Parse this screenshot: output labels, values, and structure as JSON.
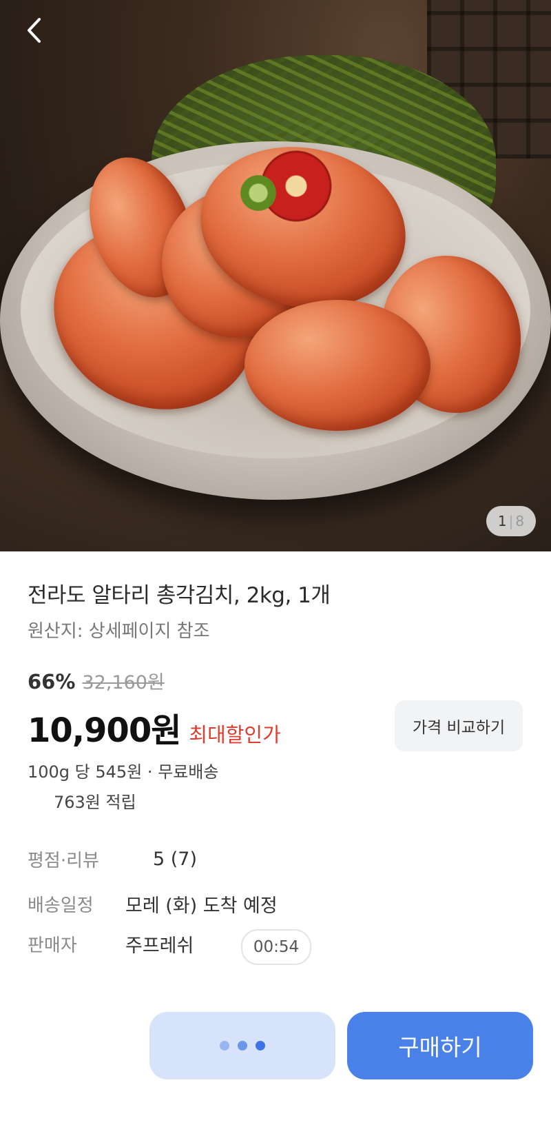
{
  "hero": {
    "back_icon": "chevron-left-icon",
    "image_index": "1",
    "image_separator": "|",
    "image_total": "8"
  },
  "product": {
    "title": "전라도 알타리 총각김치, 2kg, 1개",
    "origin": "원산지: 상세페이지 참조"
  },
  "pricing": {
    "discount": "66%",
    "original_price": "32,160원",
    "sale_price": "10,900원",
    "sale_tag": "최대할인가",
    "compare_label": "가격 비교하기",
    "unit_info": "100g 당 545원 · 무료배송",
    "reward": "763원 적립"
  },
  "info": {
    "rating_label": "평점·리뷰",
    "rating_value": "5 (7)",
    "delivery_label": "배송일정",
    "delivery_value": "모레 (화) 도착 예정",
    "seller_label": "판매자",
    "seller_value": "주프레쉬",
    "timer": "00:54"
  },
  "actions": {
    "buy_label": "구매하기"
  },
  "colors": {
    "accent": "#4a81e8",
    "accent_light": "#d6e3fb",
    "sale_red": "#e03c2e"
  }
}
